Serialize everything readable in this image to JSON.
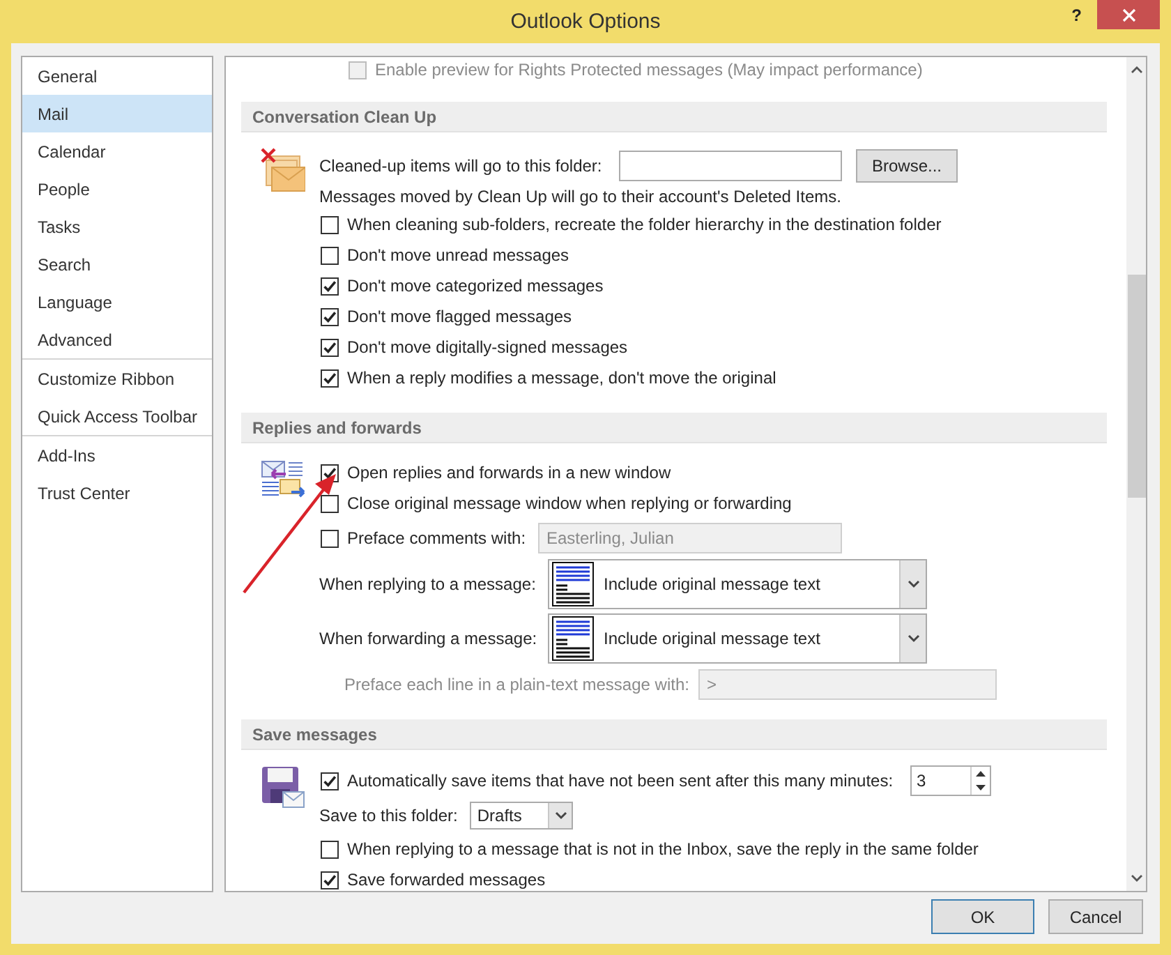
{
  "window": {
    "title": "Outlook Options",
    "help": "?"
  },
  "sidebar": {
    "groups": [
      [
        {
          "label": "General",
          "selected": false
        },
        {
          "label": "Mail",
          "selected": true
        },
        {
          "label": "Calendar",
          "selected": false
        },
        {
          "label": "People",
          "selected": false
        },
        {
          "label": "Tasks",
          "selected": false
        },
        {
          "label": "Search",
          "selected": false
        },
        {
          "label": "Language",
          "selected": false
        },
        {
          "label": "Advanced",
          "selected": false
        }
      ],
      [
        {
          "label": "Customize Ribbon",
          "selected": false
        },
        {
          "label": "Quick Access Toolbar",
          "selected": false
        }
      ],
      [
        {
          "label": "Add-Ins",
          "selected": false
        },
        {
          "label": "Trust Center",
          "selected": false
        }
      ]
    ]
  },
  "top_option": {
    "label": "Enable preview for Rights Protected messages (May impact performance)",
    "checked": false,
    "disabled": true
  },
  "sections": [
    {
      "title": "Conversation Clean Up",
      "rows": [
        {
          "kind": "folder",
          "label": "Cleaned-up items will go to this folder:",
          "button": "Browse..."
        },
        {
          "kind": "note",
          "text": "Messages moved by Clean Up will go to their account's Deleted Items."
        },
        {
          "kind": "checkbox",
          "label": "When cleaning sub-folders, recreate the folder hierarchy in the destination folder",
          "checked": false
        },
        {
          "kind": "checkbox",
          "label": "Don't move unread messages",
          "checked": false
        },
        {
          "kind": "checkbox",
          "label": "Don't move categorized messages",
          "checked": true
        },
        {
          "kind": "checkbox",
          "label": "Don't move flagged messages",
          "checked": true
        },
        {
          "kind": "checkbox",
          "label": "Don't move digitally-signed messages",
          "checked": true
        },
        {
          "kind": "checkbox",
          "label": "When a reply modifies a message, don't move the original",
          "checked": true
        }
      ]
    },
    {
      "title": "Replies and forwards",
      "rows": [
        {
          "kind": "checkbox",
          "label": "Open replies and forwards in a new window",
          "checked": true
        },
        {
          "kind": "checkbox",
          "label": "Close original message window when replying or forwarding",
          "checked": false
        },
        {
          "kind": "checkbox_field",
          "label": "Preface comments with:",
          "checked": false,
          "value": "Easterling, Julian",
          "disabled": true
        },
        {
          "kind": "dropdown",
          "label": "When replying to a message:",
          "value": "Include original message text"
        },
        {
          "kind": "dropdown",
          "label": "When forwarding a message:",
          "value": "Include original message text"
        },
        {
          "kind": "field",
          "label": "Preface each line in a plain-text message with:",
          "value": ">",
          "disabled": true
        }
      ]
    },
    {
      "title": "Save messages",
      "rows": [
        {
          "kind": "spinner",
          "label": "Automatically save items that have not been sent after this many minutes:",
          "checked": true,
          "value": "3"
        },
        {
          "kind": "combo",
          "label": "Save to this folder:",
          "value": "Drafts"
        },
        {
          "kind": "checkbox",
          "label": "When replying to a message that is not in the Inbox, save the reply in the same folder",
          "checked": false
        },
        {
          "kind": "checkbox",
          "label": "Save forwarded messages",
          "checked": true
        }
      ]
    }
  ],
  "buttons": [
    {
      "label": "OK",
      "default": true
    },
    {
      "label": "Cancel",
      "default": false
    }
  ]
}
